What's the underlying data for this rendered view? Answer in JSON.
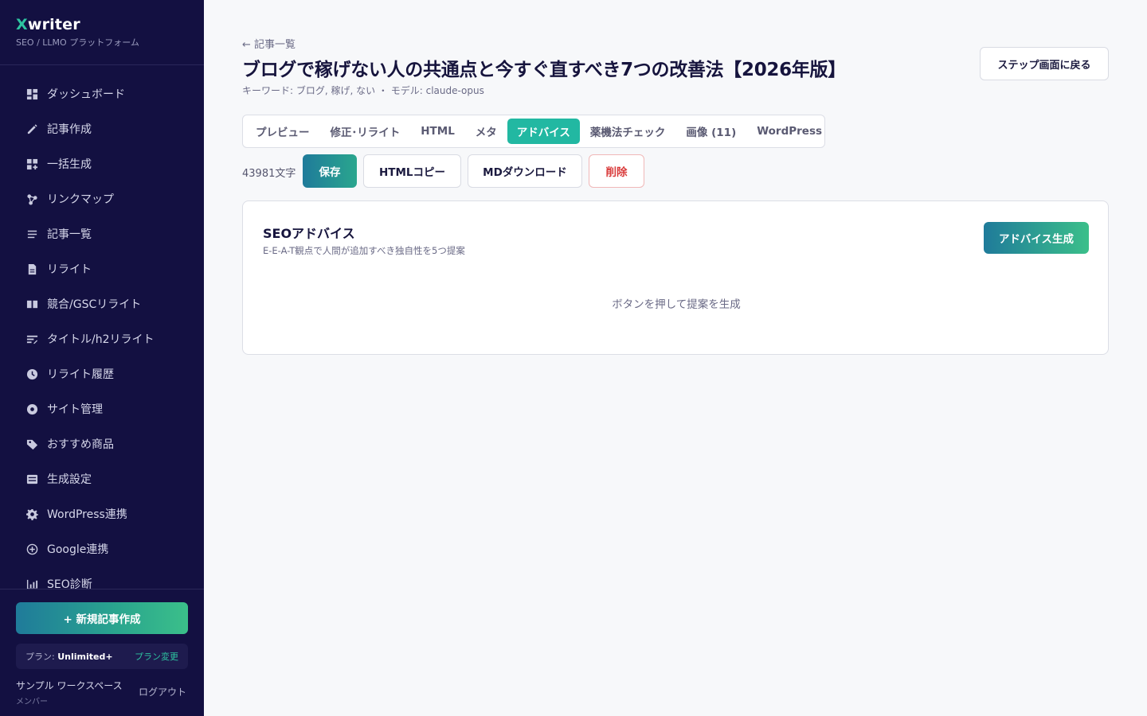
{
  "brand": {
    "x": "X",
    "rest": "writer",
    "subtitle": "SEO / LLMO プラットフォーム"
  },
  "nav": [
    {
      "label": "ダッシュボード",
      "icon": "dashboard-icon"
    },
    {
      "label": "記事作成",
      "icon": "pencil-icon"
    },
    {
      "label": "一括生成",
      "icon": "grid-plus-icon"
    },
    {
      "label": "リンクマップ",
      "icon": "network-icon"
    },
    {
      "label": "記事一覧",
      "icon": "list-icon"
    },
    {
      "label": "リライト",
      "icon": "document-icon"
    },
    {
      "label": "競合/GSCリライト",
      "icon": "book-open-icon"
    },
    {
      "label": "タイトル/h2リライト",
      "icon": "title-edit-icon"
    },
    {
      "label": "リライト履歴",
      "icon": "clock-icon"
    },
    {
      "label": "サイト管理",
      "icon": "site-icon"
    },
    {
      "label": "おすすめ商品",
      "icon": "tag-icon"
    },
    {
      "label": "生成設定",
      "icon": "settings-box-icon"
    },
    {
      "label": "WordPress連携",
      "icon": "gear-icon"
    },
    {
      "label": "Google連携",
      "icon": "plus-circle-icon"
    },
    {
      "label": "SEO診断",
      "icon": "chart-icon"
    }
  ],
  "new_article_button": "+ 新規記事作成",
  "plan": {
    "label": "プラン: ",
    "value": "Unlimited+",
    "change": "プラン変更"
  },
  "workspace": {
    "name": "サンプル ワークスペース",
    "role": "メンバー",
    "logout": "ログアウト"
  },
  "header": {
    "back": "← 記事一覧",
    "title": "ブログで稼げない人の共通点と今すぐ直すべき7つの改善法【2026年版】",
    "meta": "キーワード: ブログ, 稼げ, ない ・ モデル: claude-opus",
    "back_step_button": "ステップ画面に戻る"
  },
  "tabs": [
    {
      "label": "プレビュー",
      "active": false
    },
    {
      "label": "修正･リライト",
      "active": false
    },
    {
      "label": "HTML",
      "active": false
    },
    {
      "label": "メタ",
      "active": false
    },
    {
      "label": "アドバイス",
      "active": true
    },
    {
      "label": "薬機法チェック",
      "active": false
    },
    {
      "label": "画像 (11)",
      "active": false
    },
    {
      "label": "WordPress",
      "active": false
    }
  ],
  "toolbar": {
    "char_count": "43981文字",
    "save": "保存",
    "html_copy": "HTMLコピー",
    "md_download": "MDダウンロード",
    "delete": "削除"
  },
  "advice_card": {
    "title": "SEOアドバイス",
    "subtitle": "E-E-A-T観点で人間が追加すべき独自性を5つ提案",
    "generate_button": "アドバイス生成",
    "empty_message": "ボタンを押して提案を生成"
  },
  "colors": {
    "sidebar_bg": "#131041",
    "accent_teal": "#22b8a2",
    "danger": "#d93a3a"
  }
}
